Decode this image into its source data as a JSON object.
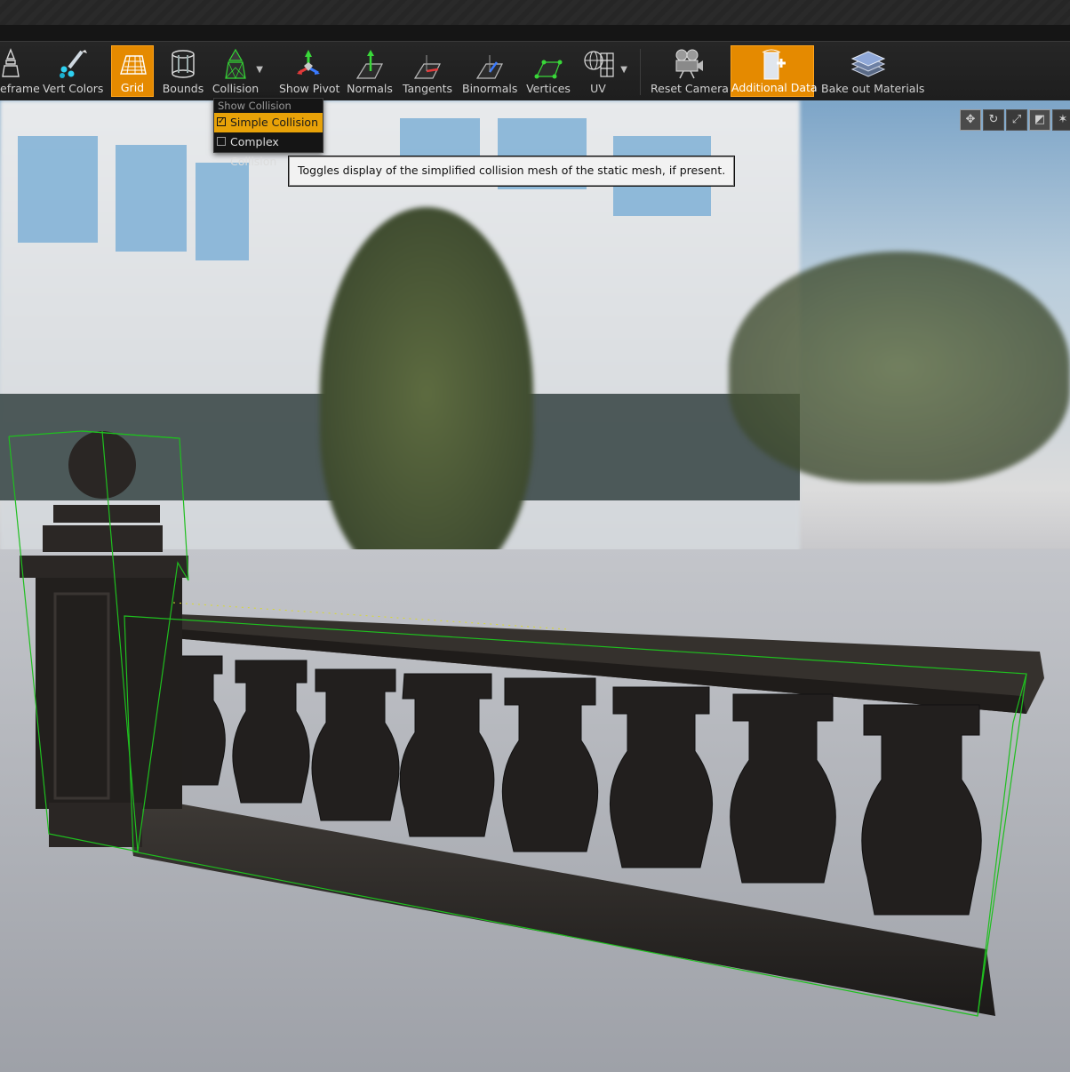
{
  "toolbar": {
    "items": [
      {
        "label": "eframe",
        "icon": "wireframe-icon",
        "active": false
      },
      {
        "label": "Vert Colors",
        "icon": "vertex-colors-icon",
        "active": false
      },
      {
        "label": "Grid",
        "icon": "grid-icon",
        "active": true
      },
      {
        "label": "Bounds",
        "icon": "bounds-icon",
        "active": false
      },
      {
        "label": "Collision",
        "icon": "collision-icon",
        "active": false
      },
      {
        "label": "Show Pivot",
        "icon": "pivot-icon",
        "active": false
      },
      {
        "label": "Normals",
        "icon": "normals-icon",
        "active": false
      },
      {
        "label": "Tangents",
        "icon": "tangents-icon",
        "active": false
      },
      {
        "label": "Binormals",
        "icon": "binormals-icon",
        "active": false
      },
      {
        "label": "Vertices",
        "icon": "vertices-icon",
        "active": false
      },
      {
        "label": "UV",
        "icon": "uv-icon",
        "active": false
      },
      {
        "label": "Reset Camera",
        "icon": "camera-icon",
        "active": false
      },
      {
        "label": "Additional Data",
        "icon": "additional-data-icon",
        "active": true
      },
      {
        "label": "Bake out Materials",
        "icon": "bake-materials-icon",
        "active": false
      }
    ]
  },
  "collision_menu": {
    "header": "Show Collision",
    "items": [
      {
        "label": "Simple Collision",
        "checked": true,
        "highlighted": true
      },
      {
        "label": "Complex Collision",
        "checked": false,
        "highlighted": false
      }
    ]
  },
  "tooltip": {
    "text": "Toggles display of the simplified collision mesh of the static mesh, if present."
  },
  "viewport_tools": [
    "translate-icon",
    "rotate-icon",
    "scale-icon",
    "surface-snap-icon",
    "world-local-icon"
  ],
  "colors": {
    "accent": "#e58a00",
    "menu_highlight": "#e8a208",
    "collision_wire": "#1fbf1f"
  }
}
